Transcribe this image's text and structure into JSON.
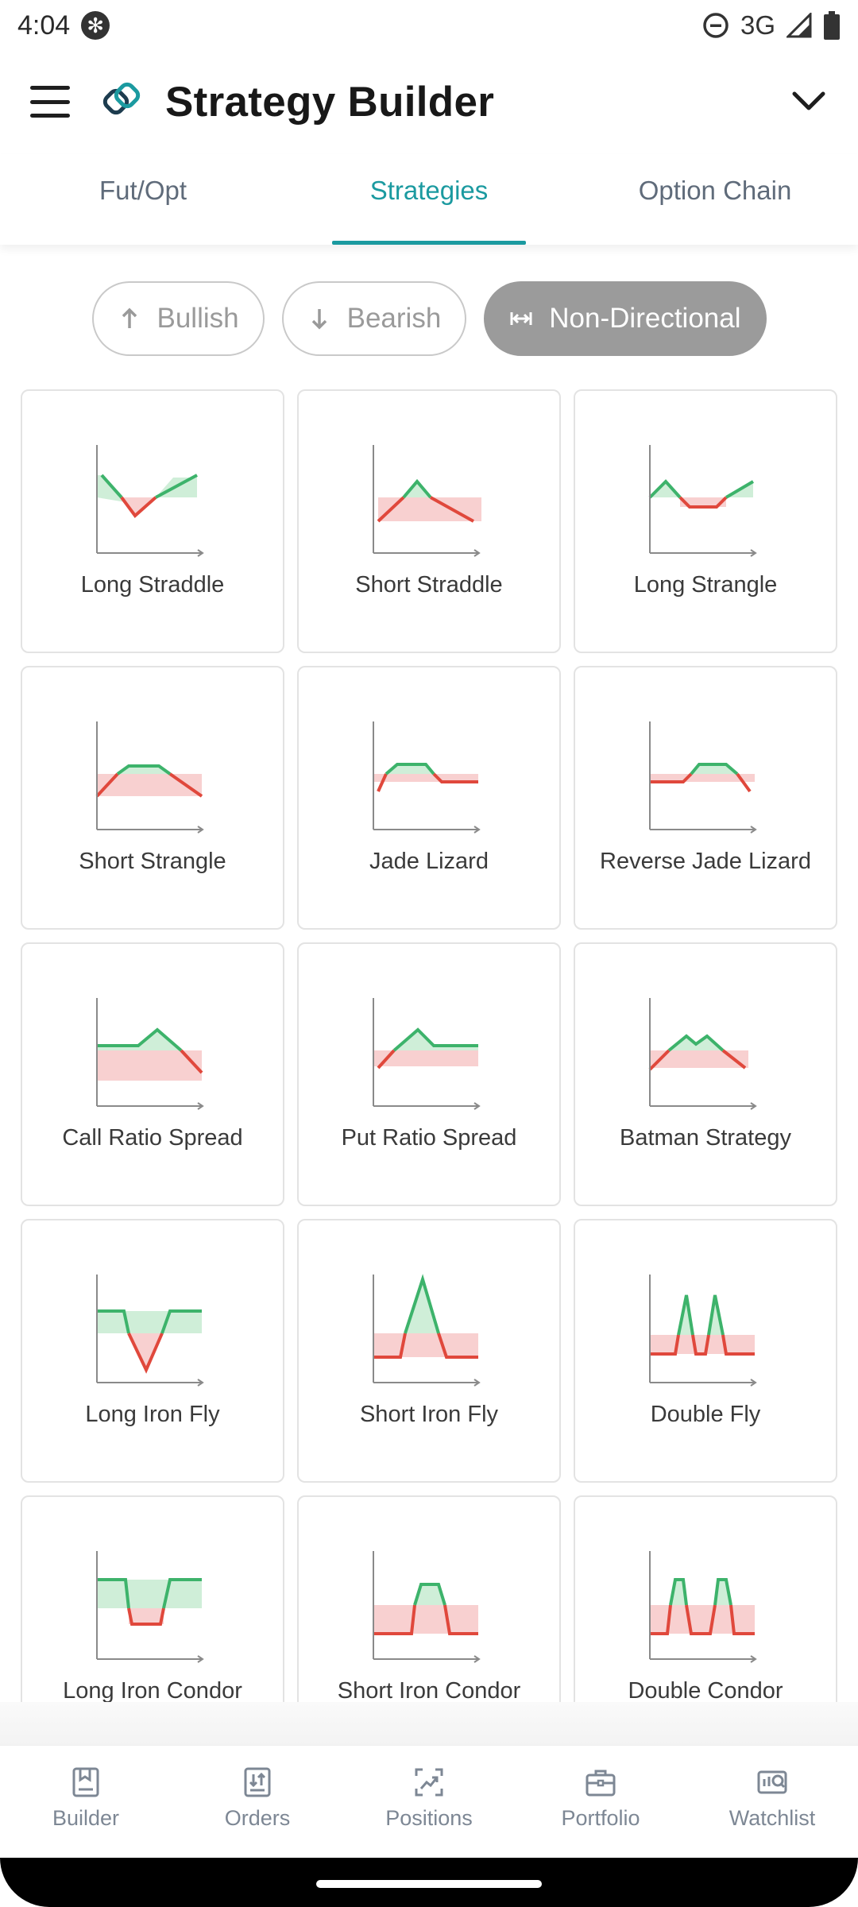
{
  "status_bar": {
    "time": "4:04",
    "network": "3G"
  },
  "app_bar": {
    "title": "Strategy Builder"
  },
  "tabs": [
    {
      "label": "Fut/Opt",
      "active": false
    },
    {
      "label": "Strategies",
      "active": true
    },
    {
      "label": "Option Chain",
      "active": false
    }
  ],
  "filters": [
    {
      "label": "Bullish",
      "icon": "arrow-up-icon",
      "selected": false
    },
    {
      "label": "Bearish",
      "icon": "arrow-down-icon",
      "selected": false
    },
    {
      "label": "Non-Directional",
      "icon": "arrows-horizontal-icon",
      "selected": true
    }
  ],
  "strategies": [
    {
      "label": "Long Straddle",
      "icon": "long-straddle-chart-icon"
    },
    {
      "label": "Short Straddle",
      "icon": "short-straddle-chart-icon"
    },
    {
      "label": "Long Strangle",
      "icon": "long-strangle-chart-icon"
    },
    {
      "label": "Short Strangle",
      "icon": "short-strangle-chart-icon"
    },
    {
      "label": "Jade Lizard",
      "icon": "jade-lizard-chart-icon"
    },
    {
      "label": "Reverse Jade Lizard",
      "icon": "reverse-jade-lizard-chart-icon"
    },
    {
      "label": "Call Ratio Spread",
      "icon": "call-ratio-spread-chart-icon"
    },
    {
      "label": "Put Ratio Spread",
      "icon": "put-ratio-spread-chart-icon"
    },
    {
      "label": "Batman Strategy",
      "icon": "batman-strategy-chart-icon"
    },
    {
      "label": "Long Iron Fly",
      "icon": "long-iron-fly-chart-icon"
    },
    {
      "label": "Short Iron Fly",
      "icon": "short-iron-fly-chart-icon"
    },
    {
      "label": "Double Fly",
      "icon": "double-fly-chart-icon"
    },
    {
      "label": "Long Iron Condor",
      "icon": "long-iron-condor-chart-icon"
    },
    {
      "label": "Short Iron Condor",
      "icon": "short-iron-condor-chart-icon"
    },
    {
      "label": "Double Condor",
      "icon": "double-condor-chart-icon"
    }
  ],
  "bottom_nav": [
    {
      "label": "Builder",
      "icon": "builder-icon"
    },
    {
      "label": "Orders",
      "icon": "orders-icon"
    },
    {
      "label": "Positions",
      "icon": "positions-icon"
    },
    {
      "label": "Portfolio",
      "icon": "portfolio-icon"
    },
    {
      "label": "Watchlist",
      "icon": "watchlist-icon"
    }
  ],
  "colors": {
    "accent": "#1b9aa0",
    "profit": "#3db36b",
    "loss": "#e0483c",
    "profit_fill": "#cfeed8",
    "loss_fill": "#f8d0d0"
  }
}
